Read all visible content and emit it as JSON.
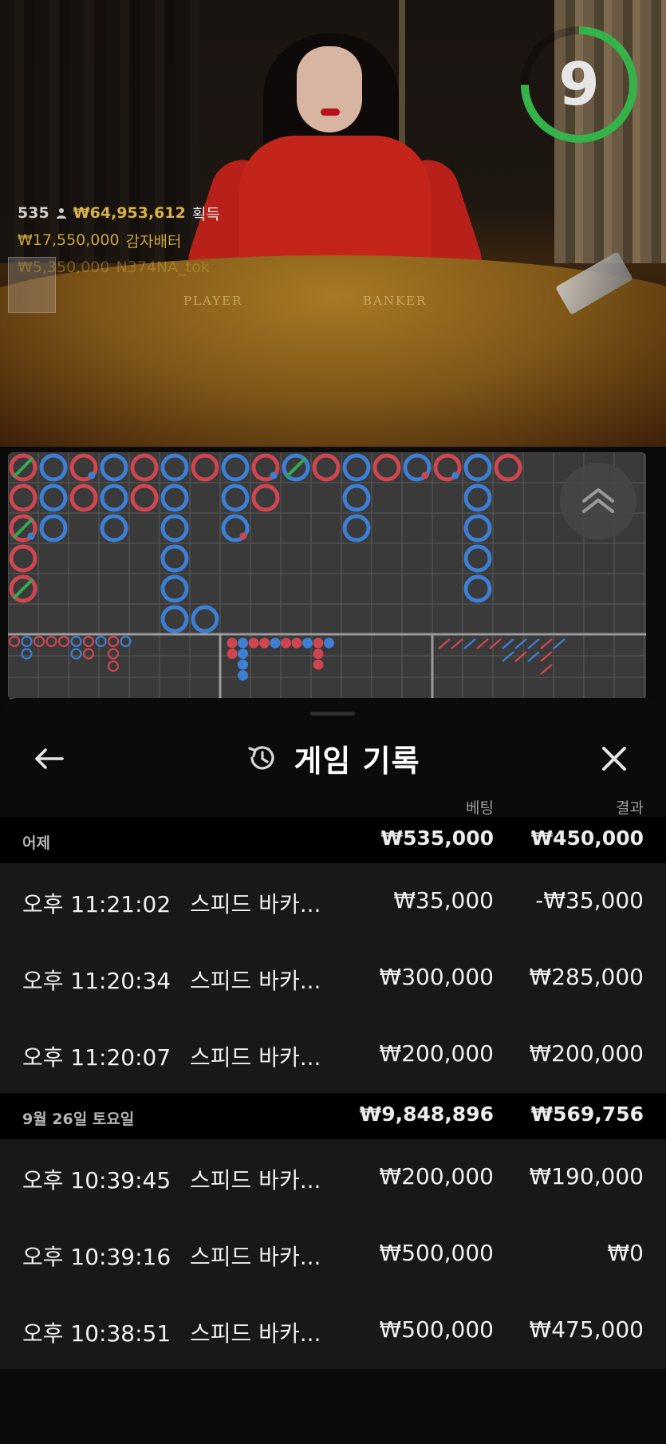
{
  "live": {
    "timer": "9",
    "stats": {
      "player_count": "535",
      "total_won": "₩64,953,612",
      "won_label": "획득",
      "top_win_amount": "₩17,550,000",
      "top_win_name": "감자배터",
      "second_win_amount": "₩5,350,000",
      "second_win_name": "N374NA_tok"
    },
    "felt_labels": {
      "player": "PLAYER",
      "banker": "BANKER"
    }
  },
  "roadmap": {
    "big_road": [
      {
        "col": 0,
        "row": 0,
        "c": "red",
        "tie": true
      },
      {
        "col": 1,
        "row": 0,
        "c": "blue"
      },
      {
        "col": 2,
        "row": 0,
        "c": "red",
        "dot": "blue"
      },
      {
        "col": 3,
        "row": 0,
        "c": "blue"
      },
      {
        "col": 4,
        "row": 0,
        "c": "red"
      },
      {
        "col": 5,
        "row": 0,
        "c": "blue"
      },
      {
        "col": 6,
        "row": 0,
        "c": "red"
      },
      {
        "col": 7,
        "row": 0,
        "c": "blue"
      },
      {
        "col": 8,
        "row": 0,
        "c": "red",
        "dot": "blue"
      },
      {
        "col": 9,
        "row": 0,
        "c": "blue",
        "tie": true
      },
      {
        "col": 10,
        "row": 0,
        "c": "red"
      },
      {
        "col": 11,
        "row": 0,
        "c": "blue"
      },
      {
        "col": 12,
        "row": 0,
        "c": "red"
      },
      {
        "col": 13,
        "row": 0,
        "c": "blue",
        "dot": "red"
      },
      {
        "col": 14,
        "row": 0,
        "c": "red",
        "dot": "blue"
      },
      {
        "col": 15,
        "row": 0,
        "c": "blue"
      },
      {
        "col": 16,
        "row": 0,
        "c": "red"
      },
      {
        "col": 0,
        "row": 1,
        "c": "red"
      },
      {
        "col": 1,
        "row": 1,
        "c": "blue"
      },
      {
        "col": 2,
        "row": 1,
        "c": "red"
      },
      {
        "col": 3,
        "row": 1,
        "c": "blue"
      },
      {
        "col": 4,
        "row": 1,
        "c": "red"
      },
      {
        "col": 5,
        "row": 1,
        "c": "blue"
      },
      {
        "col": 7,
        "row": 1,
        "c": "blue"
      },
      {
        "col": 8,
        "row": 1,
        "c": "red"
      },
      {
        "col": 11,
        "row": 1,
        "c": "blue"
      },
      {
        "col": 15,
        "row": 1,
        "c": "blue"
      },
      {
        "col": 0,
        "row": 2,
        "c": "red",
        "tie": true,
        "dot": "blue"
      },
      {
        "col": 1,
        "row": 2,
        "c": "blue"
      },
      {
        "col": 3,
        "row": 2,
        "c": "blue"
      },
      {
        "col": 5,
        "row": 2,
        "c": "blue"
      },
      {
        "col": 7,
        "row": 2,
        "c": "blue",
        "dot": "red"
      },
      {
        "col": 11,
        "row": 2,
        "c": "blue"
      },
      {
        "col": 15,
        "row": 2,
        "c": "blue"
      },
      {
        "col": 0,
        "row": 3,
        "c": "red"
      },
      {
        "col": 5,
        "row": 3,
        "c": "blue"
      },
      {
        "col": 15,
        "row": 3,
        "c": "blue"
      },
      {
        "col": 0,
        "row": 4,
        "c": "red",
        "tie": true
      },
      {
        "col": 5,
        "row": 4,
        "c": "blue"
      },
      {
        "col": 15,
        "row": 4,
        "c": "blue"
      },
      {
        "col": 5,
        "row": 5,
        "c": "blue"
      },
      {
        "col": 6,
        "row": 5,
        "c": "blue"
      }
    ],
    "big_eye": [
      {
        "col": 0,
        "row": 0,
        "c": "red"
      },
      {
        "col": 1,
        "row": 0,
        "c": "blue"
      },
      {
        "col": 1,
        "row": 1,
        "c": "blue"
      },
      {
        "col": 2,
        "row": 0,
        "c": "red"
      },
      {
        "col": 3,
        "row": 0,
        "c": "red"
      },
      {
        "col": 4,
        "row": 0,
        "c": "red"
      },
      {
        "col": 5,
        "row": 0,
        "c": "blue"
      },
      {
        "col": 5,
        "row": 1,
        "c": "blue"
      },
      {
        "col": 6,
        "row": 0,
        "c": "red"
      },
      {
        "col": 6,
        "row": 1,
        "c": "red"
      },
      {
        "col": 7,
        "row": 0,
        "c": "blue"
      },
      {
        "col": 8,
        "row": 0,
        "c": "red"
      },
      {
        "col": 8,
        "row": 1,
        "c": "red"
      },
      {
        "col": 8,
        "row": 2,
        "c": "red"
      },
      {
        "col": 9,
        "row": 0,
        "c": "blue"
      }
    ],
    "small_road": [
      {
        "col": 0,
        "row": 0,
        "c": "red"
      },
      {
        "col": 0,
        "row": 1,
        "c": "red"
      },
      {
        "col": 1,
        "row": 0,
        "c": "blue"
      },
      {
        "col": 1,
        "row": 1,
        "c": "blue"
      },
      {
        "col": 1,
        "row": 2,
        "c": "blue"
      },
      {
        "col": 1,
        "row": 3,
        "c": "blue"
      },
      {
        "col": 2,
        "row": 0,
        "c": "red"
      },
      {
        "col": 3,
        "row": 0,
        "c": "red"
      },
      {
        "col": 4,
        "row": 0,
        "c": "blue"
      },
      {
        "col": 5,
        "row": 0,
        "c": "red"
      },
      {
        "col": 6,
        "row": 0,
        "c": "red"
      },
      {
        "col": 7,
        "row": 0,
        "c": "blue"
      },
      {
        "col": 8,
        "row": 0,
        "c": "red"
      },
      {
        "col": 8,
        "row": 1,
        "c": "red"
      },
      {
        "col": 8,
        "row": 2,
        "c": "red"
      },
      {
        "col": 9,
        "row": 0,
        "c": "blue"
      }
    ],
    "cockroach": [
      {
        "col": 0,
        "row": 0,
        "c": "red"
      },
      {
        "col": 1,
        "row": 0,
        "c": "red"
      },
      {
        "col": 2,
        "row": 0,
        "c": "blue"
      },
      {
        "col": 3,
        "row": 0,
        "c": "red"
      },
      {
        "col": 4,
        "row": 0,
        "c": "red"
      },
      {
        "col": 5,
        "row": 0,
        "c": "blue"
      },
      {
        "col": 5,
        "row": 1,
        "c": "blue"
      },
      {
        "col": 6,
        "row": 0,
        "c": "blue"
      },
      {
        "col": 6,
        "row": 1,
        "c": "red"
      },
      {
        "col": 7,
        "row": 0,
        "c": "blue"
      },
      {
        "col": 7,
        "row": 1,
        "c": "blue"
      },
      {
        "col": 8,
        "row": 0,
        "c": "red"
      },
      {
        "col": 8,
        "row": 1,
        "c": "red"
      },
      {
        "col": 8,
        "row": 2,
        "c": "red"
      },
      {
        "col": 9,
        "row": 0,
        "c": "blue"
      }
    ],
    "colors": {
      "red": "#cf4650",
      "blue": "#3d7fd4",
      "tie": "#33a852",
      "grid": "#5a5a5a",
      "bg": "#3a3a3a"
    }
  },
  "sheet": {
    "title": "게임 기록",
    "columns": {
      "bet": "베팅",
      "result": "결과"
    },
    "groups": [
      {
        "label": "어제",
        "bet_total": "₩535,000",
        "result_total": "₩450,000",
        "rows": [
          {
            "time": "오후 11:21:02",
            "game": "스피드 바카...",
            "bet": "₩35,000",
            "result": "-₩35,000"
          },
          {
            "time": "오후 11:20:34",
            "game": "스피드 바카...",
            "bet": "₩300,000",
            "result": "₩285,000"
          },
          {
            "time": "오후 11:20:07",
            "game": "스피드 바카...",
            "bet": "₩200,000",
            "result": "₩200,000"
          }
        ]
      },
      {
        "label": "9월 26일 토요일",
        "bet_total": "₩9,848,896",
        "result_total": "₩569,756",
        "rows": [
          {
            "time": "오후 10:39:45",
            "game": "스피드 바카...",
            "bet": "₩200,000",
            "result": "₩190,000"
          },
          {
            "time": "오후 10:39:16",
            "game": "스피드 바카...",
            "bet": "₩500,000",
            "result": "₩0"
          },
          {
            "time": "오후 10:38:51",
            "game": "스피드 바카...",
            "bet": "₩500,000",
            "result": "₩475,000"
          }
        ]
      }
    ]
  }
}
